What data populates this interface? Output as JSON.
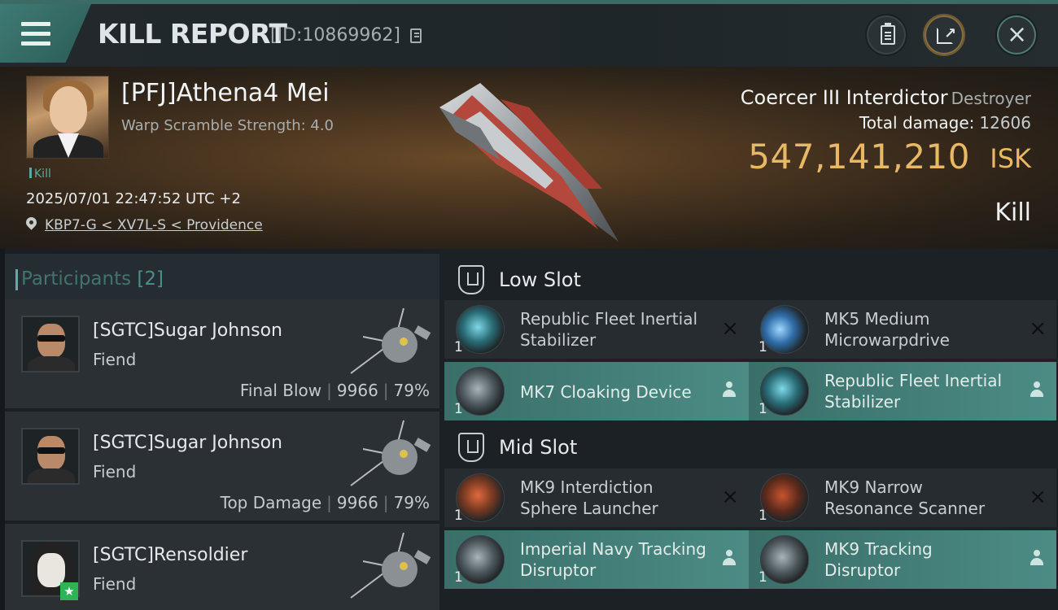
{
  "header": {
    "title": "KILL REPORT",
    "report_id": "[ID:10869962]"
  },
  "victim": {
    "name": "[PFJ]Athena4 Mei",
    "warp_scramble": "Warp Scramble Strength: 4.0",
    "tag": "Kill",
    "timestamp": "2025/07/01 22:47:52 UTC +2",
    "location": "KBP7-G < XV7L-S < Providence",
    "ship_name": "Coercer III Interdictor",
    "ship_class": "Destroyer",
    "total_damage_label": "Total damage:",
    "total_damage": "12606",
    "isk_value": "547,141,210",
    "isk_unit": "ISK",
    "result": "Kill"
  },
  "participants": {
    "title": "Participants",
    "count": "[2]",
    "rows": [
      {
        "name": "[SGTC]Sugar Johnson",
        "ship": "Fiend",
        "role": "Final Blow",
        "damage": "9966",
        "percent": "79%"
      },
      {
        "name": "[SGTC]Sugar Johnson",
        "ship": "Fiend",
        "role": "Top Damage",
        "damage": "9966",
        "percent": "79%"
      },
      {
        "name": "[SGTC]Rensoldier",
        "ship": "Fiend"
      }
    ]
  },
  "slots": {
    "low": {
      "label": "Low Slot",
      "modules": [
        {
          "name": "Republic Fleet Inertial Stabilizer",
          "qty": "1",
          "state": "destroyed",
          "icon": "inertial-stabilizer-icon"
        },
        {
          "name": "MK5 Medium Microwarpdrive",
          "qty": "1",
          "state": "destroyed",
          "icon": "microwarpdrive-icon"
        },
        {
          "name": "MK7 Cloaking Device",
          "qty": "1",
          "state": "dropped",
          "icon": "cloaking-device-icon"
        },
        {
          "name": "Republic Fleet Inertial Stabilizer",
          "qty": "1",
          "state": "dropped",
          "icon": "inertial-stabilizer-icon"
        }
      ]
    },
    "mid": {
      "label": "Mid Slot",
      "modules": [
        {
          "name": "MK9 Interdiction Sphere Launcher",
          "qty": "1",
          "state": "destroyed",
          "icon": "sphere-launcher-icon"
        },
        {
          "name": "MK9 Narrow Resonance Scanner",
          "qty": "1",
          "state": "destroyed",
          "icon": "resonance-scanner-icon"
        },
        {
          "name": "Imperial Navy Tracking Disruptor",
          "qty": "1",
          "state": "dropped",
          "icon": "tracking-disruptor-icon"
        },
        {
          "name": "MK9 Tracking Disruptor",
          "qty": "1",
          "state": "dropped",
          "icon": "tracking-disruptor-icon"
        }
      ]
    }
  },
  "icons": {
    "destroyed": "×",
    "menu": "menu-icon",
    "close": "×"
  },
  "colors": {
    "accent_teal": "#4c8c85",
    "isk_gold": "#e8b866",
    "fitted_bg": "#3a6e69"
  }
}
